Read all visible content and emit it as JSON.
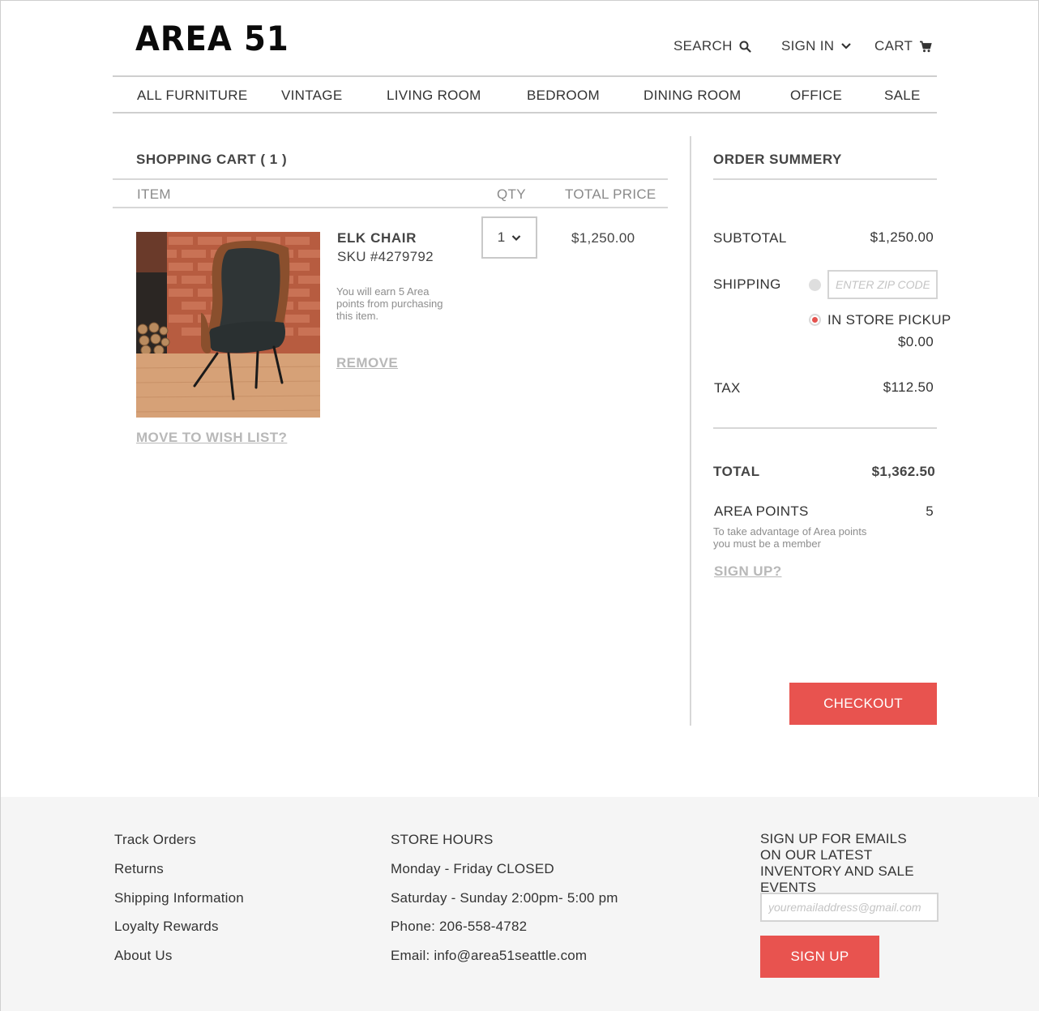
{
  "brand": {
    "logo": "AREA 51"
  },
  "header": {
    "search_label": "SEARCH",
    "signin_label": "SIGN IN",
    "cart_label": "CART"
  },
  "nav": {
    "items": [
      {
        "label": "ALL FURNITURE"
      },
      {
        "label": "VINTAGE"
      },
      {
        "label": "LIVING ROOM"
      },
      {
        "label": "BEDROOM"
      },
      {
        "label": "DINING ROOM"
      },
      {
        "label": "OFFICE"
      },
      {
        "label": "SALE"
      }
    ]
  },
  "cart": {
    "title": "SHOPPING CART ( 1 )",
    "columns": {
      "item": "ITEM",
      "qty": "QTY",
      "total": "TOTAL PRICE"
    },
    "items": [
      {
        "name": "ELK CHAIR",
        "sku": "SKU #4279792",
        "note": "You will earn 5 Area points from purchasing this item.",
        "qty": "1",
        "price": "$1,250.00",
        "remove_label": "REMOVE"
      }
    ],
    "wishlist_label": "MOVE TO WISH LIST?"
  },
  "summary": {
    "title": "ORDER SUMMERY",
    "subtotal_label": "SUBTOTAL",
    "subtotal_value": "$1,250.00",
    "shipping_label": "SHIPPING",
    "zip_placeholder": "ENTER ZIP CODE",
    "pickup_label": "IN STORE PICKUP",
    "pickup_value": "$0.00",
    "tax_label": "TAX",
    "tax_value": "$112.50",
    "total_label": "TOTAL",
    "total_value": "$1,362.50",
    "points_label": "AREA POINTS",
    "points_value": "5",
    "points_note": "To take advantage of Area points you must be a member",
    "signup_link": "SIGN UP?",
    "checkout_label": "CHECKOUT"
  },
  "footer": {
    "links": [
      {
        "label": "Track Orders"
      },
      {
        "label": "Returns"
      },
      {
        "label": "Shipping Information"
      },
      {
        "label": "Loyalty Rewards"
      },
      {
        "label": "About Us"
      }
    ],
    "store": {
      "heading": "STORE HOURS",
      "weekday": "Monday - Friday CLOSED",
      "weekend": "Saturday - Sunday 2:00pm- 5:00 pm",
      "phone": "Phone: 206-558-4782",
      "email": "Email: info@area51seattle.com"
    },
    "newsletter": {
      "heading": "SIGN UP FOR EMAILS ON OUR LATEST INVENTORY AND SALE EVENTS",
      "email_placeholder": "youremailaddress@gmail.com",
      "button_label": "SIGN UP"
    }
  },
  "colors": {
    "accent": "#e8534f",
    "divider": "#d7d7d7",
    "footer_bg": "#f5f5f5",
    "muted_link": "#b8b8b8"
  },
  "icons": {
    "search": "search-icon",
    "signin": "chevron-down-icon",
    "cart": "cart-icon",
    "qty": "chevron-down-icon"
  }
}
